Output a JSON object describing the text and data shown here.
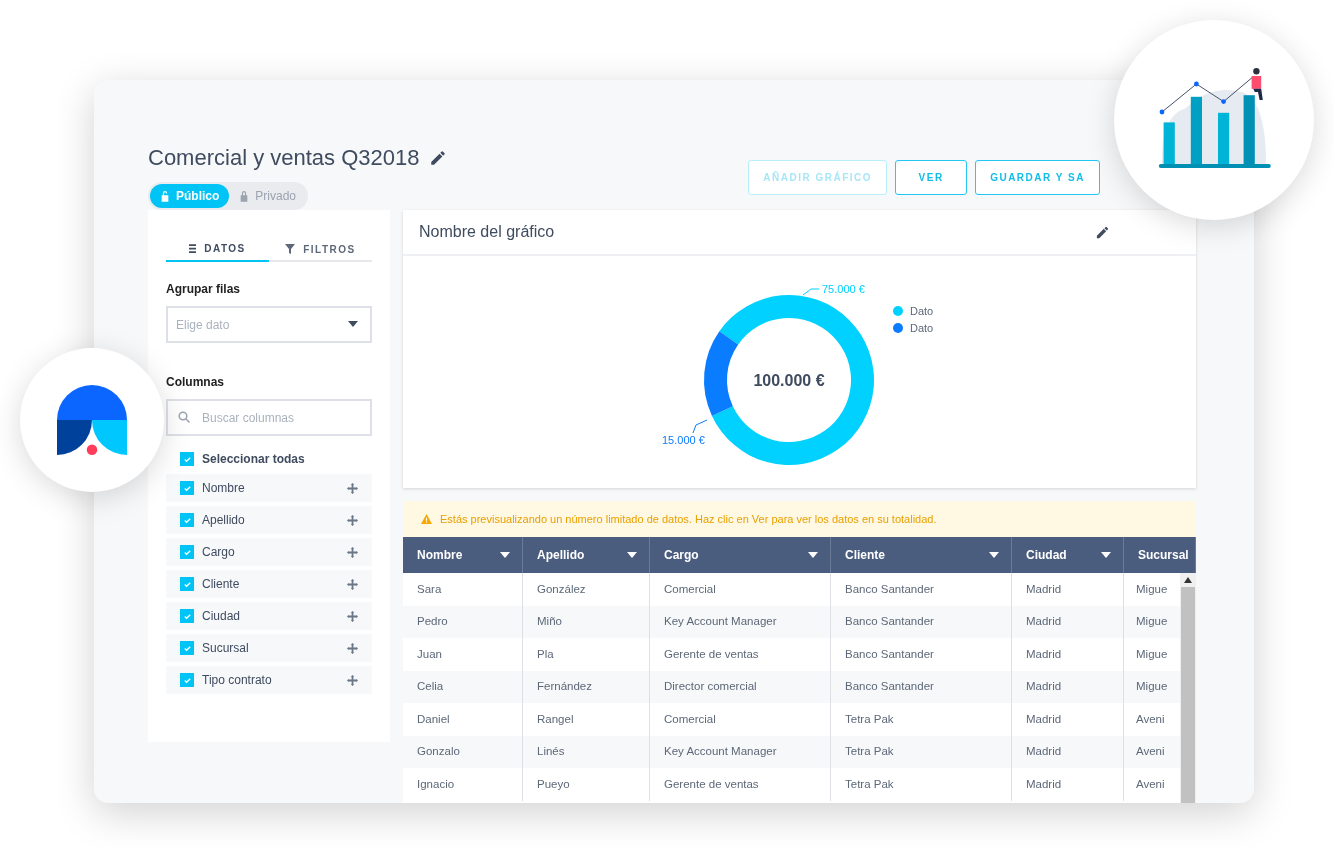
{
  "report": {
    "title": "Comercial y ventas Q32018",
    "visibility": [
      {
        "label": "Público",
        "selected": true
      },
      {
        "label": "Privado",
        "selected": false
      }
    ]
  },
  "actions": [
    {
      "label": "AÑADIR GRÁFICO",
      "disabled": true
    },
    {
      "label": "VER",
      "disabled": false
    },
    {
      "label": "GUARDAR Y SA",
      "disabled": false
    }
  ],
  "sidebar": {
    "tabs": [
      {
        "label": "DATOS",
        "selected": true
      },
      {
        "label": "FILTROS",
        "selected": false
      }
    ],
    "group_rows": {
      "label": "Agrupar filas",
      "placeholder": "Elige dato"
    },
    "columns": {
      "label": "Columnas",
      "search_placeholder": "Buscar columnas",
      "select_all": {
        "label": "Seleccionar todas",
        "checked": true
      },
      "items": [
        {
          "label": "Nombre",
          "checked": true
        },
        {
          "label": "Apellido",
          "checked": true
        },
        {
          "label": "Cargo",
          "checked": true
        },
        {
          "label": "Cliente",
          "checked": true
        },
        {
          "label": "Ciudad",
          "checked": true
        },
        {
          "label": "Sucursal",
          "checked": true
        },
        {
          "label": "Tipo contrato",
          "checked": true
        }
      ]
    }
  },
  "chart_panel": {
    "title": "Nombre del gráfico",
    "center_label": "100.000 €",
    "legend": [
      {
        "color": "#00d1ff"
      },
      {
        "color": "#0a7cff"
      }
    ],
    "chart_data": {
      "type": "donut",
      "categories": [
        "Dato",
        "Dato"
      ],
      "values": [
        75000,
        15000
      ],
      "value_labels": [
        "75.000 €",
        "15.000 €"
      ]
    }
  },
  "notice": "Estás previsualizando un número limitado de datos. Haz clic en Ver para ver los datos en su totalidad.",
  "table": {
    "columns": [
      {
        "label": "Nombre",
        "menu": true
      },
      {
        "label": "Apellido",
        "menu": true
      },
      {
        "label": "Cargo",
        "menu": true
      },
      {
        "label": "Cliente",
        "menu": true
      },
      {
        "label": "Ciudad",
        "menu": true
      },
      {
        "label": "Sucursal",
        "menu": false
      }
    ],
    "rows": [
      [
        "Sara",
        "González",
        "Comercial",
        "Banco Santander",
        "Madrid",
        "Migue"
      ],
      [
        "Pedro",
        "Miño",
        "Key Account Manager",
        "Banco Santander",
        "Madrid",
        "Migue"
      ],
      [
        "Juan",
        "Pla",
        "Gerente de ventas",
        "Banco Santander",
        "Madrid",
        "Migue"
      ],
      [
        "Celia",
        "Fernández",
        "Director comercial",
        "Banco Santander",
        "Madrid",
        "Migue"
      ],
      [
        "Daniel",
        "Rangel",
        "Comercial",
        "Tetra Pak",
        "Madrid",
        "Aveni"
      ],
      [
        "Gonzalo",
        "Linés",
        "Key Account Manager",
        "Tetra Pak",
        "Madrid",
        "Aveni"
      ],
      [
        "Ignacio",
        "Pueyo",
        "Gerente de ventas",
        "Tetra Pak",
        "Madrid",
        "Aveni"
      ]
    ]
  }
}
